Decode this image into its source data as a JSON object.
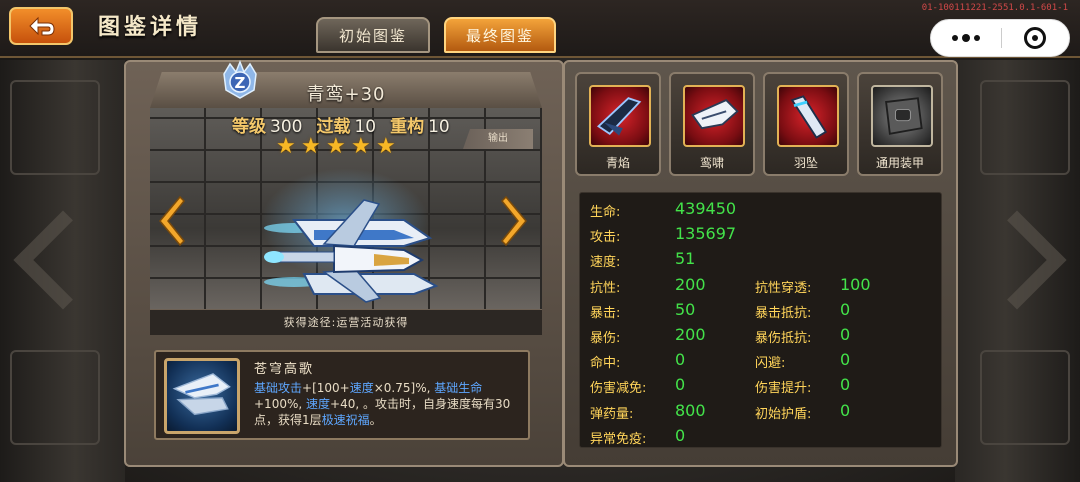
{
  "header": {
    "title": "图鉴详情",
    "build_id": "01-100111221-2551.0.1-601-1",
    "tabs": [
      {
        "label": "初始图鉴",
        "active": false
      },
      {
        "label": "最终图鉴",
        "active": true
      }
    ]
  },
  "ship": {
    "name": "青鸾+30",
    "level_label": "等级",
    "level": "300",
    "overload_label": "过载",
    "overload": "10",
    "rebuild_label": "重构",
    "rebuild": "10",
    "stars": 5,
    "output_tag": "输出",
    "acquire": "获得途径:运营活动获得"
  },
  "skill": {
    "name": "苍穹高歌",
    "desc_parts": [
      {
        "t": "基础攻击",
        "hl": true
      },
      {
        "t": "+[100+",
        "hl": false
      },
      {
        "t": "速度",
        "hl": true
      },
      {
        "t": "×0.75]%, ",
        "hl": false
      },
      {
        "t": "基础生命",
        "hl": true
      },
      {
        "t": "+100%, ",
        "hl": false
      },
      {
        "t": "速度",
        "hl": true
      },
      {
        "t": "+40, 。攻击时，自身速度每有30点，获得1层",
        "hl": false
      },
      {
        "t": "极速祝福",
        "hl": true
      },
      {
        "t": "。",
        "hl": false
      }
    ]
  },
  "equipment": [
    {
      "label": "青焰",
      "icon": "blade-icon"
    },
    {
      "label": "鸾啸",
      "icon": "wing-icon"
    },
    {
      "label": "羽坠",
      "icon": "feather-icon"
    },
    {
      "label": "通用装甲",
      "icon": "armor-icon"
    }
  ],
  "attributes": {
    "left": [
      {
        "label": "生命:",
        "value": "439450"
      },
      {
        "label": "攻击:",
        "value": "135697"
      },
      {
        "label": "速度:",
        "value": "51"
      },
      {
        "label": "抗性:",
        "value": "200"
      },
      {
        "label": "暴击:",
        "value": "50"
      },
      {
        "label": "暴伤:",
        "value": "200"
      },
      {
        "label": "命中:",
        "value": "0"
      },
      {
        "label": "伤害减免:",
        "value": "0"
      },
      {
        "label": "弹药量:",
        "value": "800"
      },
      {
        "label": "异常免疫:",
        "value": "0"
      }
    ],
    "right": [
      {
        "label": "抗性穿透:",
        "value": "100",
        "row": 3
      },
      {
        "label": "暴击抵抗:",
        "value": "0",
        "row": 4
      },
      {
        "label": "暴伤抵抗:",
        "value": "0",
        "row": 5
      },
      {
        "label": "闪避:",
        "value": "0",
        "row": 6
      },
      {
        "label": "伤害提升:",
        "value": "0",
        "row": 7
      },
      {
        "label": "初始护盾:",
        "value": "0",
        "row": 8
      }
    ]
  },
  "colors": {
    "label": "#ffd45a",
    "value": "#43e34a",
    "highlight": "#5ea7ff",
    "accent": "#f28e2a"
  }
}
